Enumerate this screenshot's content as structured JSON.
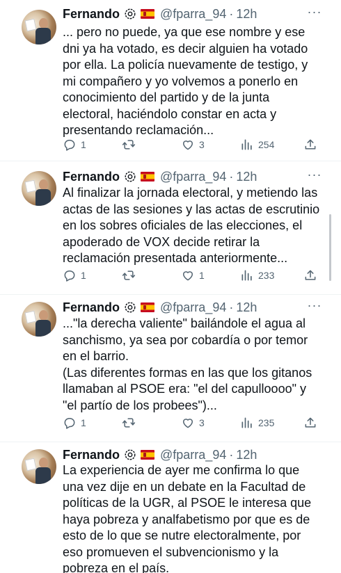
{
  "tweets": [
    {
      "name": "Fernando",
      "handle": "@fparra_94",
      "separator": "·",
      "time": "12h",
      "text": "... pero no puede, ya que ese nombre y ese\ndni ya ha votado, es decir alguien ha votado\npor ella. La policía nuevamente de testigo, y\nmi compañero y yo volvemos a ponerlo en\nconocimiento del partido y de la junta\nelectoral, haciéndolo constar en acta y\npresentando reclamación...",
      "replies": "1",
      "retweets": "",
      "likes": "3",
      "views": "254"
    },
    {
      "name": "Fernando",
      "handle": "@fparra_94",
      "separator": "·",
      "time": "12h",
      "text": "Al finalizar la jornada electoral, y metiendo las\nactas de las sesiones y las actas de escrutinio\nen los sobres oficiales de las elecciones, el\napoderado de VOX decide retirar la\nreclamación presentada anteriormente...",
      "replies": "1",
      "retweets": "",
      "likes": "1",
      "views": "233"
    },
    {
      "name": "Fernando",
      "handle": "@fparra_94",
      "separator": "·",
      "time": "12h",
      "text": "...\"la derecha valiente\" bailándole el agua al\nsanchismo, ya sea por cobardía o por temor\nen el barrio.\n(Las diferentes formas en las que los gitanos\nllamaban al PSOE era: \"el del capulloooo\" y\n\"el partío de los probees\")...",
      "replies": "1",
      "retweets": "",
      "likes": "3",
      "views": "235"
    },
    {
      "name": "Fernando",
      "handle": "@fparra_94",
      "separator": "·",
      "time": "12h",
      "text": "La experiencia de ayer me confirma lo que\nuna vez dije en un debate en la Facultad de\npolíticas de la UGR, al PSOE le interesa que\nhaya pobreza y analfabetismo por que es de\nesto de lo que se nutre electoralmente, por\neso promueven el subvencionismo y la\npobreza en el país."
    }
  ],
  "icons": {
    "verified": "verified-badge-icon",
    "flag": "spain-flag-icon",
    "more": "more-options-icon",
    "reply": "reply-icon",
    "retweet": "retweet-icon",
    "like": "heart-icon",
    "views": "views-chart-icon",
    "share": "share-icon"
  },
  "colors": {
    "text": "#0f1419",
    "secondary": "#536471",
    "divider": "#eff3f4",
    "flag_red": "#c60b1e",
    "flag_yellow": "#ffc400"
  }
}
